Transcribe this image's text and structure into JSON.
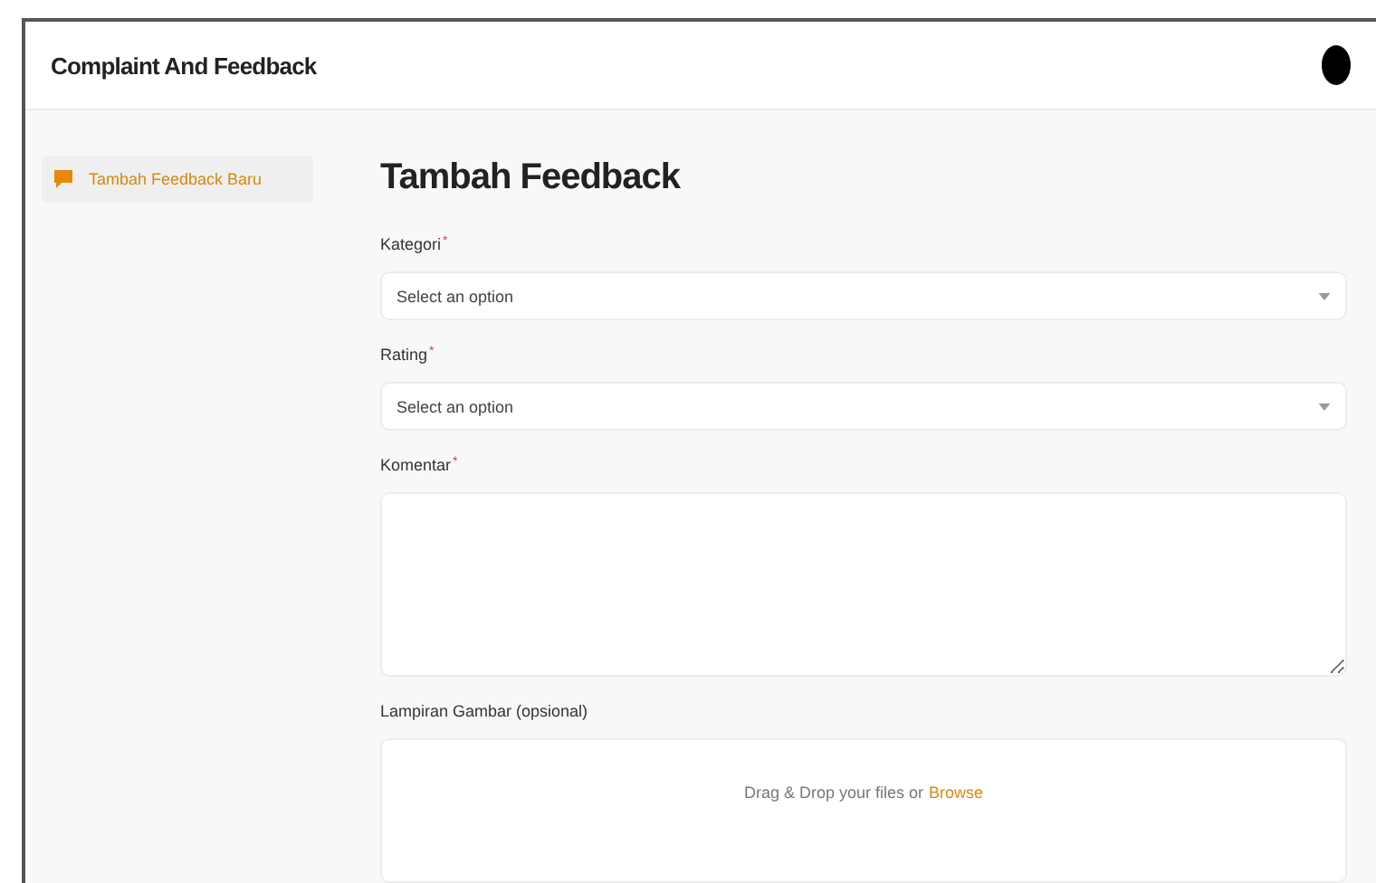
{
  "header": {
    "title": "Complaint And Feedback"
  },
  "sidebar": {
    "items": [
      {
        "label": "Tambah Feedback Baru",
        "selected": true
      }
    ]
  },
  "page_title": "Tambah Feedback",
  "fields": [
    {
      "kind": "select",
      "label": "Kategori",
      "required_mark": "*",
      "placeholder": "Select an option"
    },
    {
      "kind": "select",
      "label": "Rating",
      "required_mark": "*",
      "placeholder": "Select an option"
    },
    {
      "kind": "textarea",
      "label": "Komentar",
      "required_mark": "*"
    },
    {
      "kind": "file",
      "label": "Lampiran Gambar (opsional)",
      "hint": "Drag & Drop your files or",
      "link": "Browse"
    }
  ]
}
